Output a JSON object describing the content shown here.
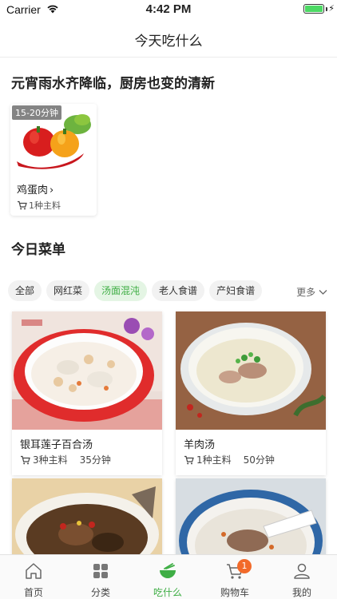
{
  "status_bar": {
    "carrier": "Carrier",
    "time": "4:42 PM"
  },
  "nav": {
    "title": "今天吃什么"
  },
  "featured": {
    "title": "元宵雨水齐降临，厨房也变的清新",
    "card": {
      "time_tag": "15-20分钟",
      "name": "鸡蛋肉",
      "ingredients": "1种主料"
    }
  },
  "today_menu": {
    "title": "今日菜单",
    "chips": [
      "全部",
      "网红菜",
      "汤面混沌",
      "老人食谱",
      "产妇食谱"
    ],
    "active_chip": "汤面混沌",
    "more_label": "更多",
    "recipes": [
      {
        "name": "银耳莲子百合汤",
        "ingredients": "3种主料",
        "time": "35分钟"
      },
      {
        "name": "羊肉汤",
        "ingredients": "1种主料",
        "time": "50分钟"
      },
      {
        "name": "",
        "ingredients": "",
        "time": ""
      },
      {
        "name": "",
        "ingredients": "",
        "time": ""
      }
    ]
  },
  "tab_bar": {
    "tabs": [
      {
        "label": "首页",
        "icon": "home-icon"
      },
      {
        "label": "分类",
        "icon": "grid-icon"
      },
      {
        "label": "吃什么",
        "icon": "bowl-icon"
      },
      {
        "label": "购物车",
        "icon": "cart-icon"
      },
      {
        "label": "我的",
        "icon": "user-icon"
      }
    ],
    "active_index": 2,
    "cart_badge": "1"
  },
  "colors": {
    "accent": "#3fae45",
    "badge": "#f26a2a",
    "chip_bg": "#f2f2f2"
  }
}
